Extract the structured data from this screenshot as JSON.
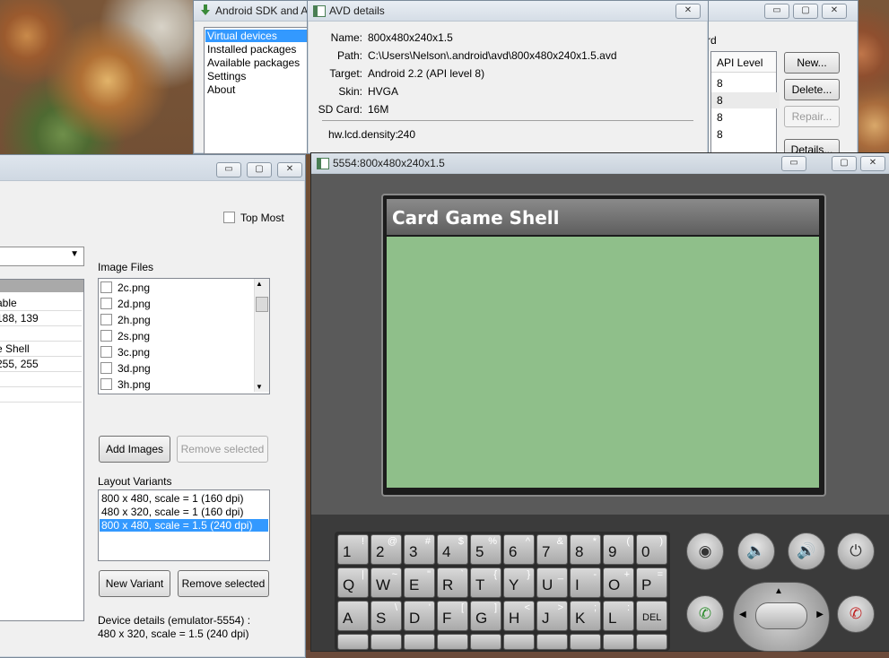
{
  "sdk_window": {
    "title": "Android SDK and A",
    "nav_items": [
      "Virtual devices",
      "Installed packages",
      "Available packages",
      "Settings",
      "About"
    ],
    "partial_header": "rd",
    "api_column_header": "API Level",
    "api_levels": [
      "8",
      "8",
      "8",
      "8"
    ],
    "buttons": {
      "new": "New...",
      "delete": "Delete...",
      "repair": "Repair...",
      "details": "Details..."
    }
  },
  "avd_details": {
    "title": "AVD details",
    "rows": [
      {
        "label": "Name:",
        "value": "800x480x240x1.5"
      },
      {
        "label": "Path:",
        "value": "C:\\Users\\Nelson\\.android\\avd\\800x480x240x1.5.avd"
      },
      {
        "label": "Target:",
        "value": "Android 2.2 (API level 8)"
      },
      {
        "label": "Skin:",
        "value": "HVGA"
      },
      {
        "label": "SD Card:",
        "value": "16M"
      }
    ],
    "property": {
      "label": "hw.lcd.density:",
      "value": "240"
    }
  },
  "tool_window": {
    "top_most_label": "Top Most",
    "left_list": [
      "able",
      "188, 139",
      "",
      "e Shell",
      "255, 255"
    ],
    "image_files_label": "Image Files",
    "image_files": [
      "2c.png",
      "2d.png",
      "2h.png",
      "2s.png",
      "3c.png",
      "3d.png",
      "3h.png"
    ],
    "add_images": "Add Images",
    "remove_selected_images": "Remove selected",
    "layout_variants_label": "Layout Variants",
    "layout_variants": [
      "800 x 480, scale = 1 (160 dpi)",
      "480 x 320, scale = 1 (160 dpi)",
      "800 x 480, scale = 1.5 (240 dpi)"
    ],
    "selected_variant_index": 2,
    "new_variant": "New Variant",
    "remove_selected_variant": "Remove selected",
    "device_details_line1": "Device details (emulator-5554) :",
    "device_details_line2": "480 x 320, scale = 1.5 (240 dpi)"
  },
  "emulator": {
    "title": "5554:800x480x240x1.5",
    "app_title": "Card Game Shell",
    "screen_color": "#8fbf8a",
    "keyboard_rows": [
      [
        [
          "1",
          "!"
        ],
        [
          "2",
          "@"
        ],
        [
          "3",
          "#"
        ],
        [
          "4",
          "$"
        ],
        [
          "5",
          "%"
        ],
        [
          "6",
          "^"
        ],
        [
          "7",
          "&"
        ],
        [
          "8",
          "*"
        ],
        [
          "9",
          "("
        ],
        [
          "0",
          ")"
        ]
      ],
      [
        [
          "Q",
          "|"
        ],
        [
          "W",
          "~"
        ],
        [
          "E",
          "\""
        ],
        [
          "R",
          "`"
        ],
        [
          "T",
          "{"
        ],
        [
          "Y",
          "}"
        ],
        [
          "U",
          "_"
        ],
        [
          "I",
          "-"
        ],
        [
          "O",
          "+"
        ],
        [
          "P",
          "="
        ]
      ],
      [
        [
          "A",
          ""
        ],
        [
          "S",
          "\\"
        ],
        [
          "D",
          "'"
        ],
        [
          "F",
          "["
        ],
        [
          "G",
          "]"
        ],
        [
          "H",
          "<"
        ],
        [
          "J",
          ">"
        ],
        [
          "K",
          ";"
        ],
        [
          "L",
          ":"
        ],
        [
          "DEL",
          ""
        ]
      ]
    ],
    "hw_buttons": [
      "camera-icon",
      "volume-down-icon",
      "volume-up-icon",
      "power-icon"
    ]
  },
  "window_buttons": {
    "minimize": "▭",
    "maximize": "▢",
    "close": "✕"
  },
  "colors": {
    "selection": "#3399ff",
    "app_bar": "#6a6a6a"
  }
}
